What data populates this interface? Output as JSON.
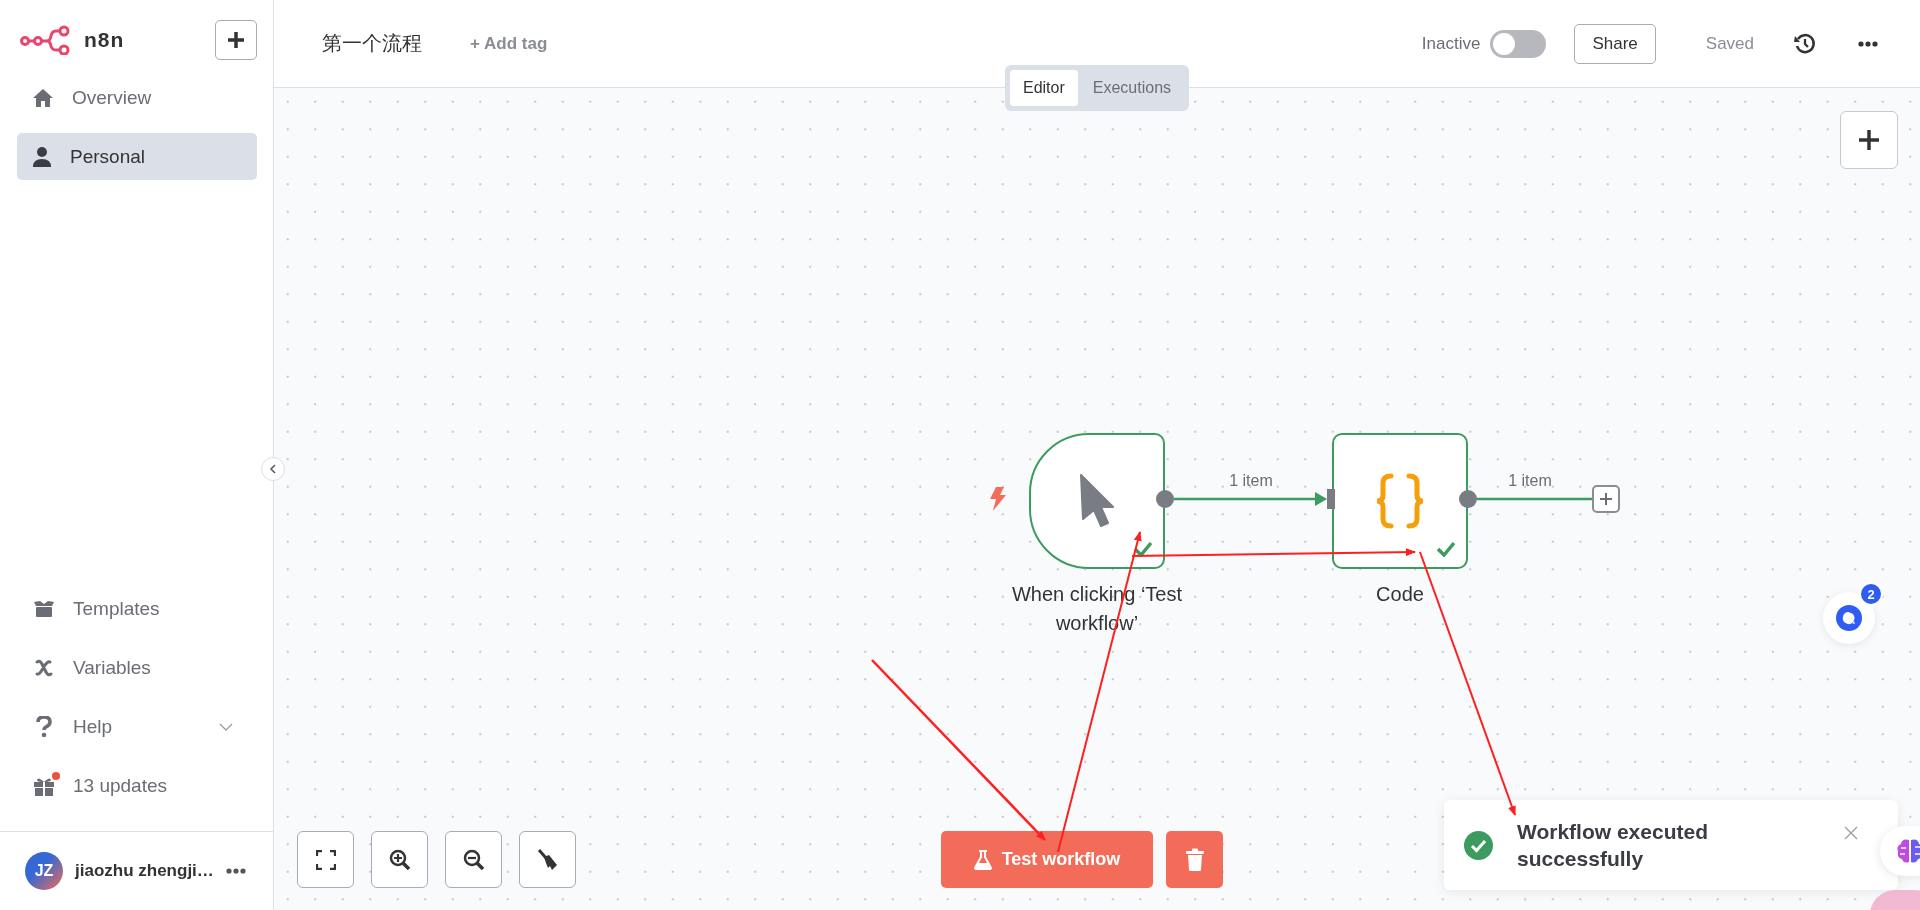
{
  "sidebar": {
    "logo": "n8n",
    "nav": [
      {
        "label": "Overview",
        "selected": false
      },
      {
        "label": "Personal",
        "selected": true
      }
    ],
    "bottom_items": [
      {
        "label": "Templates",
        "expandable": false,
        "unread": false
      },
      {
        "label": "Variables",
        "expandable": false,
        "unread": false
      },
      {
        "label": "Help",
        "expandable": true,
        "unread": false
      },
      {
        "label": "13 updates",
        "expandable": false,
        "unread": true
      }
    ],
    "user": {
      "initials": "JZ",
      "name": "jiaozhu zhengji…"
    }
  },
  "topbar": {
    "title": "第一个流程",
    "add_tag": "+ Add tag",
    "active_toggle": {
      "label": "Inactive",
      "on": false
    },
    "share": "Share",
    "status": "Saved"
  },
  "view_tabs": [
    {
      "label": "Editor",
      "selected": true
    },
    {
      "label": "Executions",
      "selected": false
    }
  ],
  "nodes": [
    {
      "kind": "trigger",
      "name": "When clicking ‘Test workflow’",
      "success": true
    },
    {
      "kind": "code",
      "name": "Code",
      "success": true
    }
  ],
  "connections": [
    {
      "label": "1 item"
    },
    {
      "label": "1 item"
    }
  ],
  "test_button": "Test workflow",
  "toast": {
    "message": "Workflow executed successfully"
  },
  "chat_badge": "2"
}
